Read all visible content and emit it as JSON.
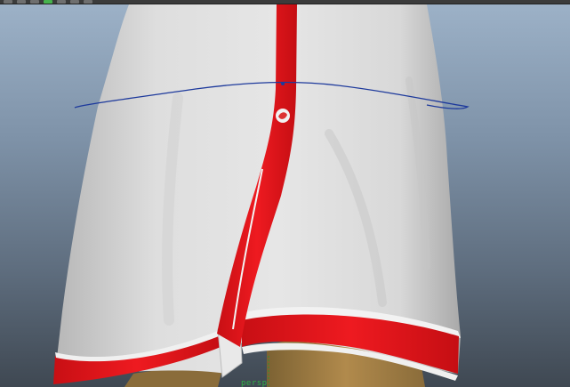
{
  "viewport": {
    "camera_label": "persp",
    "background_top": "#9db2c8",
    "background_bottom": "#3f4852"
  },
  "toolbar": {
    "icons": [
      "select-tool-icon",
      "move-tool-icon",
      "rotate-tool-icon",
      "scale-tool-icon",
      "snap-icon",
      "render-icon",
      "camera-icon"
    ]
  },
  "model": {
    "skirt_color": "#e2e2e2",
    "stripe_color": "#e8141a",
    "skin_color": "#b0884a",
    "curve_color": "#1e3a9c"
  }
}
